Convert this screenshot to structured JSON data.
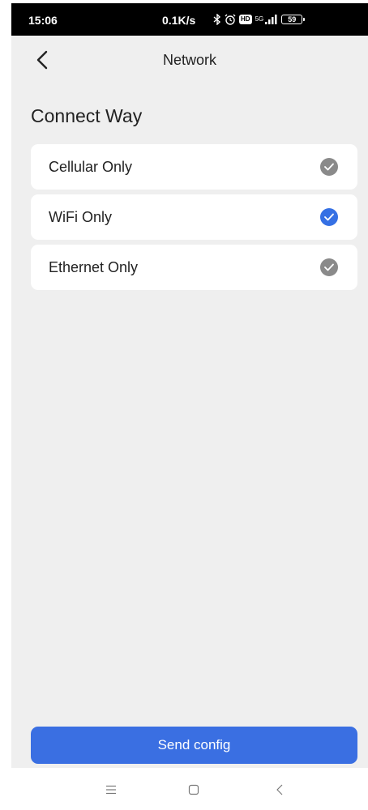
{
  "status_bar": {
    "time": "15:06",
    "net_speed": "0.1K/s",
    "network_type": "5G",
    "battery": "59",
    "icons": [
      "bluetooth-icon",
      "alarm-icon",
      "hd-icon",
      "signal-icon",
      "battery-icon"
    ]
  },
  "header": {
    "back_icon": "chevron-left-icon",
    "title": "Network"
  },
  "section": {
    "title": "Connect Way"
  },
  "options": [
    {
      "label": "Cellular Only",
      "selected": false
    },
    {
      "label": "WiFi Only",
      "selected": true
    },
    {
      "label": "Ethernet Only",
      "selected": false
    }
  ],
  "actions": {
    "send_label": "Send config"
  },
  "system_nav": {
    "menu_icon": "menu-icon",
    "home_icon": "home-square-icon",
    "back_icon": "back-chevron-icon"
  },
  "colors": {
    "accent": "#3a6fe2",
    "check_selected": "#3570e4",
    "check_unselected": "#8a8a8a",
    "background": "#efefef",
    "card": "#ffffff"
  }
}
